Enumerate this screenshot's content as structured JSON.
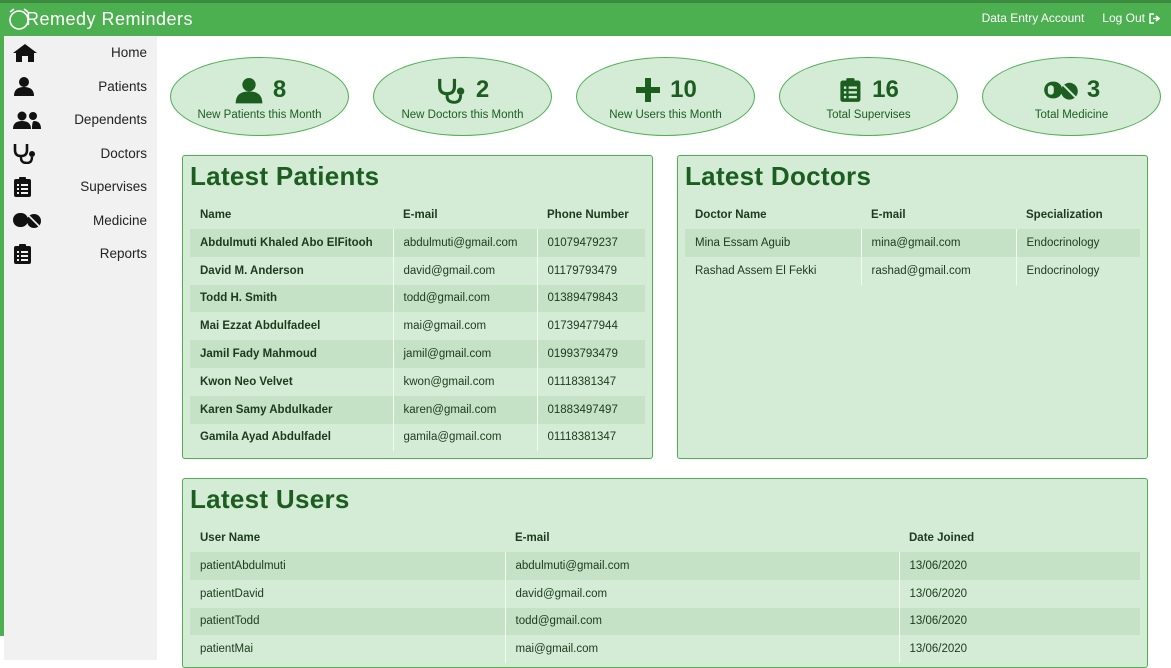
{
  "app": {
    "brand": "Remedy Reminders",
    "account_label": "Data Entry Account",
    "logout_label": "Log Out"
  },
  "sidebar": {
    "items": [
      {
        "label": "Home",
        "icon": "home-icon"
      },
      {
        "label": "Patients",
        "icon": "user-icon"
      },
      {
        "label": "Dependents",
        "icon": "users-icon"
      },
      {
        "label": "Doctors",
        "icon": "stethoscope-icon"
      },
      {
        "label": "Supervises",
        "icon": "clipboard-icon"
      },
      {
        "label": "Medicine",
        "icon": "pills-icon"
      },
      {
        "label": "Reports",
        "icon": "clipboard-icon"
      }
    ]
  },
  "stats": [
    {
      "value": "8",
      "caption": "New Patients this Month",
      "icon": "user-icon"
    },
    {
      "value": "2",
      "caption": "New Doctors this Month",
      "icon": "stethoscope-icon"
    },
    {
      "value": "10",
      "caption": "New Users this Month",
      "icon": "plus-icon"
    },
    {
      "value": "16",
      "caption": "Total Supervises",
      "icon": "clipboard-icon"
    },
    {
      "value": "3",
      "caption": "Total Medicine",
      "icon": "pills-icon"
    }
  ],
  "patients": {
    "title": "Latest Patients",
    "headers": [
      "Name",
      "E-mail",
      "Phone Number"
    ],
    "rows": [
      [
        "Abdulmuti Khaled Abo ElFitooh",
        "abdulmuti@gmail.com",
        "01079479237"
      ],
      [
        "David M. Anderson",
        "david@gmail.com",
        "01179793479"
      ],
      [
        "Todd H. Smith",
        "todd@gmail.com",
        "01389479843"
      ],
      [
        "Mai Ezzat Abdulfadeel",
        "mai@gmail.com",
        "01739477944"
      ],
      [
        "Jamil Fady Mahmoud",
        "jamil@gmail.com",
        "01993793479"
      ],
      [
        "Kwon Neo Velvet",
        "kwon@gmail.com",
        "01118381347"
      ],
      [
        "Karen Samy Abdulkader",
        "karen@gmail.com",
        "01883497497"
      ],
      [
        "Gamila Ayad Abdulfadel",
        "gamila@gmail.com",
        "01118381347"
      ]
    ]
  },
  "doctors": {
    "title": "Latest Doctors",
    "headers": [
      "Doctor Name",
      "E-mail",
      "Specialization"
    ],
    "rows": [
      [
        "Mina Essam Aguib",
        "mina@gmail.com",
        "Endocrinology"
      ],
      [
        "Rashad Assem El Fekki",
        "rashad@gmail.com",
        "Endocrinology"
      ]
    ]
  },
  "users": {
    "title": "Latest Users",
    "headers": [
      "User Name",
      "E-mail",
      "Date Joined"
    ],
    "rows": [
      [
        "patientAbdulmuti",
        "abdulmuti@gmail.com",
        "13/06/2020"
      ],
      [
        "patientDavid",
        "david@gmail.com",
        "13/06/2020"
      ],
      [
        "patientTodd",
        "todd@gmail.com",
        "13/06/2020"
      ],
      [
        "patientMai",
        "mai@gmail.com",
        "13/06/2020"
      ]
    ]
  },
  "colors": {
    "brand_green": "#4caf50",
    "panel_bg": "#d4ecd5",
    "title_green": "#1b5e20"
  }
}
